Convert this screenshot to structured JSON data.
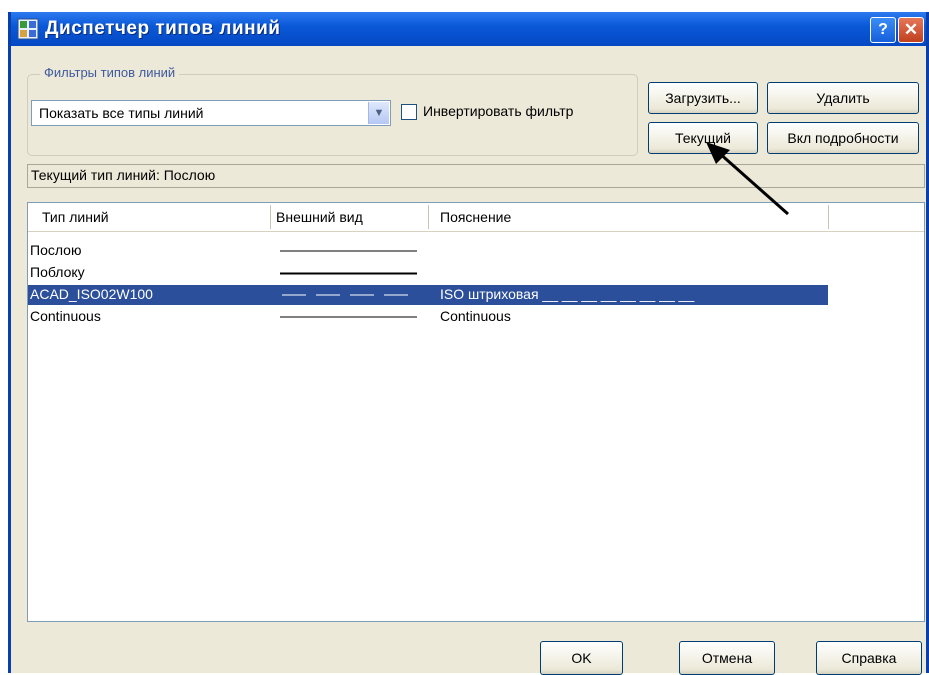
{
  "window": {
    "title": "Диспетчер типов линий",
    "help_glyph": "?",
    "close_glyph": "✕",
    "icon": "linetype-manager-icon"
  },
  "filters": {
    "legend": "Фильтры типов линий",
    "selected": "Показать все типы линий",
    "invert_label": "Инвертировать фильтр",
    "invert_checked": false
  },
  "buttons": {
    "load": "Загрузить...",
    "delete": "Удалить",
    "current": "Текущий",
    "details": "Вкл подробности",
    "ok": "OK",
    "cancel": "Отмена",
    "help": "Справка"
  },
  "current_linetype": "Текущий тип линий:  Послою",
  "table": {
    "columns": [
      "Тип линий",
      "Внешний вид",
      "Пояснение"
    ],
    "rows": [
      {
        "name": "Послою",
        "description": "",
        "style": "solid",
        "selected": false
      },
      {
        "name": "Поблоку",
        "description": "",
        "style": "solid-bold",
        "selected": false
      },
      {
        "name": "ACAD_ISO02W100",
        "description": "ISO штриховая __ __ __ __ __ __ __ __",
        "style": "dashed",
        "selected": true
      },
      {
        "name": "Continuous",
        "description": "Continuous",
        "style": "solid",
        "selected": false
      }
    ]
  },
  "colors": {
    "title_bar": "#0a59d8",
    "selection": "#2b4f9a",
    "dialog_bg": "#ece9d8"
  }
}
